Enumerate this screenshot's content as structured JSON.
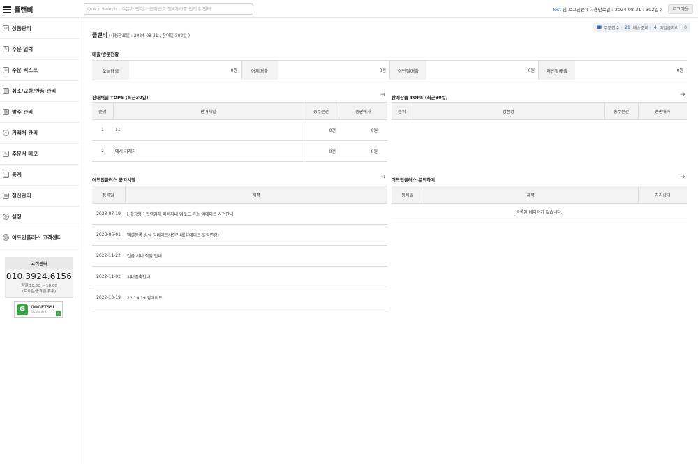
{
  "header": {
    "brand": "플랜비",
    "search_placeholder": "Quick Search : 주문자 명이나 전화번호 뒷4자리를 입력후 엔터",
    "user_name": "test",
    "user_suffix": " 님 로그인중 ( 사용만료일 : 2024-08-31 : 302일 )",
    "logout_label": "로그아웃"
  },
  "sidebar": {
    "items": [
      {
        "label": "상품관리",
        "icon": "settings-icon"
      },
      {
        "label": "주문 입력",
        "icon": "edit-icon"
      },
      {
        "label": "주문 리스트",
        "icon": "list-icon"
      },
      {
        "label": "취소/교환/반품 관리",
        "icon": "clipboard-icon"
      },
      {
        "label": "발주 관리",
        "icon": "order-icon"
      },
      {
        "label": "거래처 관리",
        "icon": "user-icon"
      },
      {
        "label": "주문서 메모",
        "icon": "memo-icon"
      },
      {
        "label": "통계",
        "icon": "chart-icon"
      },
      {
        "label": "정산관리",
        "icon": "calculator-icon"
      },
      {
        "label": "설정",
        "icon": "gear-icon"
      },
      {
        "label": "어드민플러스 고객센터",
        "icon": "headset-icon"
      }
    ],
    "cs": {
      "title": "고객센터",
      "phone": "010.3924.6156",
      "hours1": "평일 10:00 ~ 18:00",
      "hours2": "(토요일/공휴일 휴무)"
    },
    "ssl": {
      "name": "GOGETSSL",
      "sub": "SSL UNLIM RT"
    }
  },
  "status": {
    "bars": "IIIII",
    "orders_label": "주문접수 :",
    "orders_count": "21",
    "ship_label": "배송준비 :",
    "ship_count": "4",
    "unpaid_label": "미입금처리 :",
    "unpaid_count": "0"
  },
  "company": {
    "name": "플랜비",
    "meta": " (사용만료일 : 2024-08-31 , 잔여일 302일 )"
  },
  "sales": {
    "title": "매출/방문현황",
    "cells": [
      {
        "label": "오늘매출",
        "value": "0원"
      },
      {
        "label": "어제매출",
        "value": "0원"
      },
      {
        "label": "이번달매출",
        "value": "0원"
      },
      {
        "label": "저번달매출",
        "value": "0원"
      }
    ]
  },
  "channels": {
    "title": "판매채널 TOP5 (최근30일)",
    "headers": [
      "순위",
      "판매채널",
      "총주문건",
      "총판매가"
    ],
    "rows": [
      {
        "rank": "1",
        "name": "11",
        "count": "0건",
        "price": "0원"
      },
      {
        "rank": "2",
        "name": "예시 거래처",
        "count": "0건",
        "price": "0원"
      }
    ]
  },
  "products": {
    "title": "판매상품 TOP5 (최근30일)",
    "headers": [
      "순위",
      "상품명",
      "총주문건",
      "총판매가"
    ]
  },
  "notices": {
    "title": "어드민플러스 공지사항",
    "headers": [
      "등록일",
      "제목"
    ],
    "rows": [
      {
        "date": "2023-07-19",
        "title": "[ 확장형 ] 협력업체 페이지내 업로드 기능 업데이트 사전안내"
      },
      {
        "date": "2023-06-01",
        "title": "엑셀등록 방식 업데이트사전안내(업데이트 일정변경)"
      },
      {
        "date": "2022-11-22",
        "title": "긴급 서버 작업 안내"
      },
      {
        "date": "2022-11-02",
        "title": "서버증축안내"
      },
      {
        "date": "2022-10-19",
        "title": "22.10.19 업데이트"
      }
    ]
  },
  "inquiries": {
    "title": "어드민플러스 문의하기",
    "headers": [
      "등록일",
      "제목",
      "처리상태"
    ],
    "empty": "등록된 데이터가 없습니다."
  },
  "icons": {
    "arrow": "→"
  }
}
